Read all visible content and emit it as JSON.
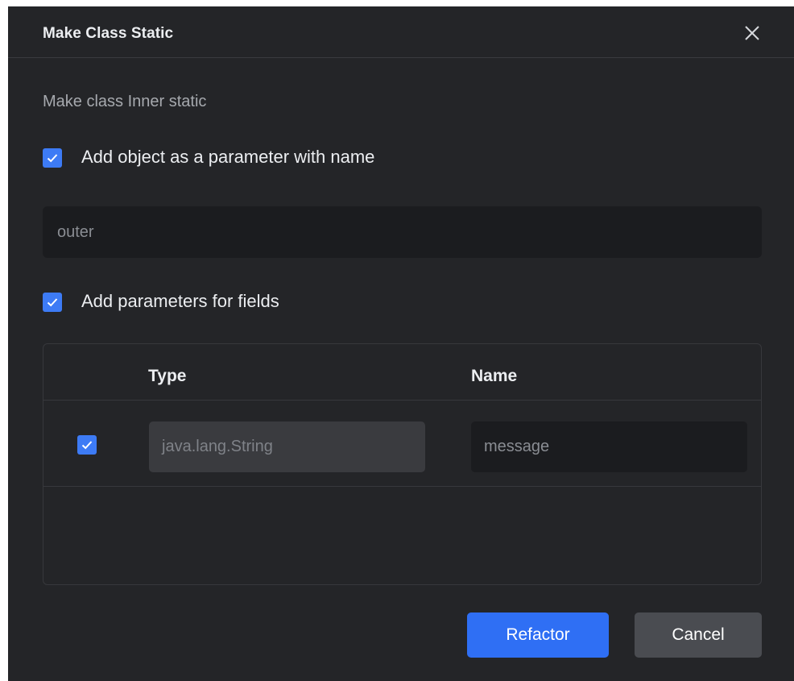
{
  "dialog": {
    "title": "Make Class Static",
    "subtitle": "Make class Inner static",
    "options": {
      "add_object_param": {
        "label": "Add object as a parameter with name",
        "checked": true
      },
      "param_name": {
        "value": "outer"
      },
      "add_field_params": {
        "label": "Add parameters for fields",
        "checked": true
      }
    },
    "table": {
      "columns": [
        "Type",
        "Name"
      ],
      "rows": [
        {
          "checked": true,
          "type": "java.lang.String",
          "name": "message"
        }
      ]
    },
    "buttons": {
      "refactor": "Refactor",
      "cancel": "Cancel"
    }
  },
  "colors": {
    "dialog_bg": "#242528",
    "accent": "#3d7bf5",
    "primary_button": "#2f6ff4",
    "secondary_button": "#4a4c51",
    "input_bg": "#1b1c1f",
    "disabled_input_bg": "#3a3b3f"
  }
}
